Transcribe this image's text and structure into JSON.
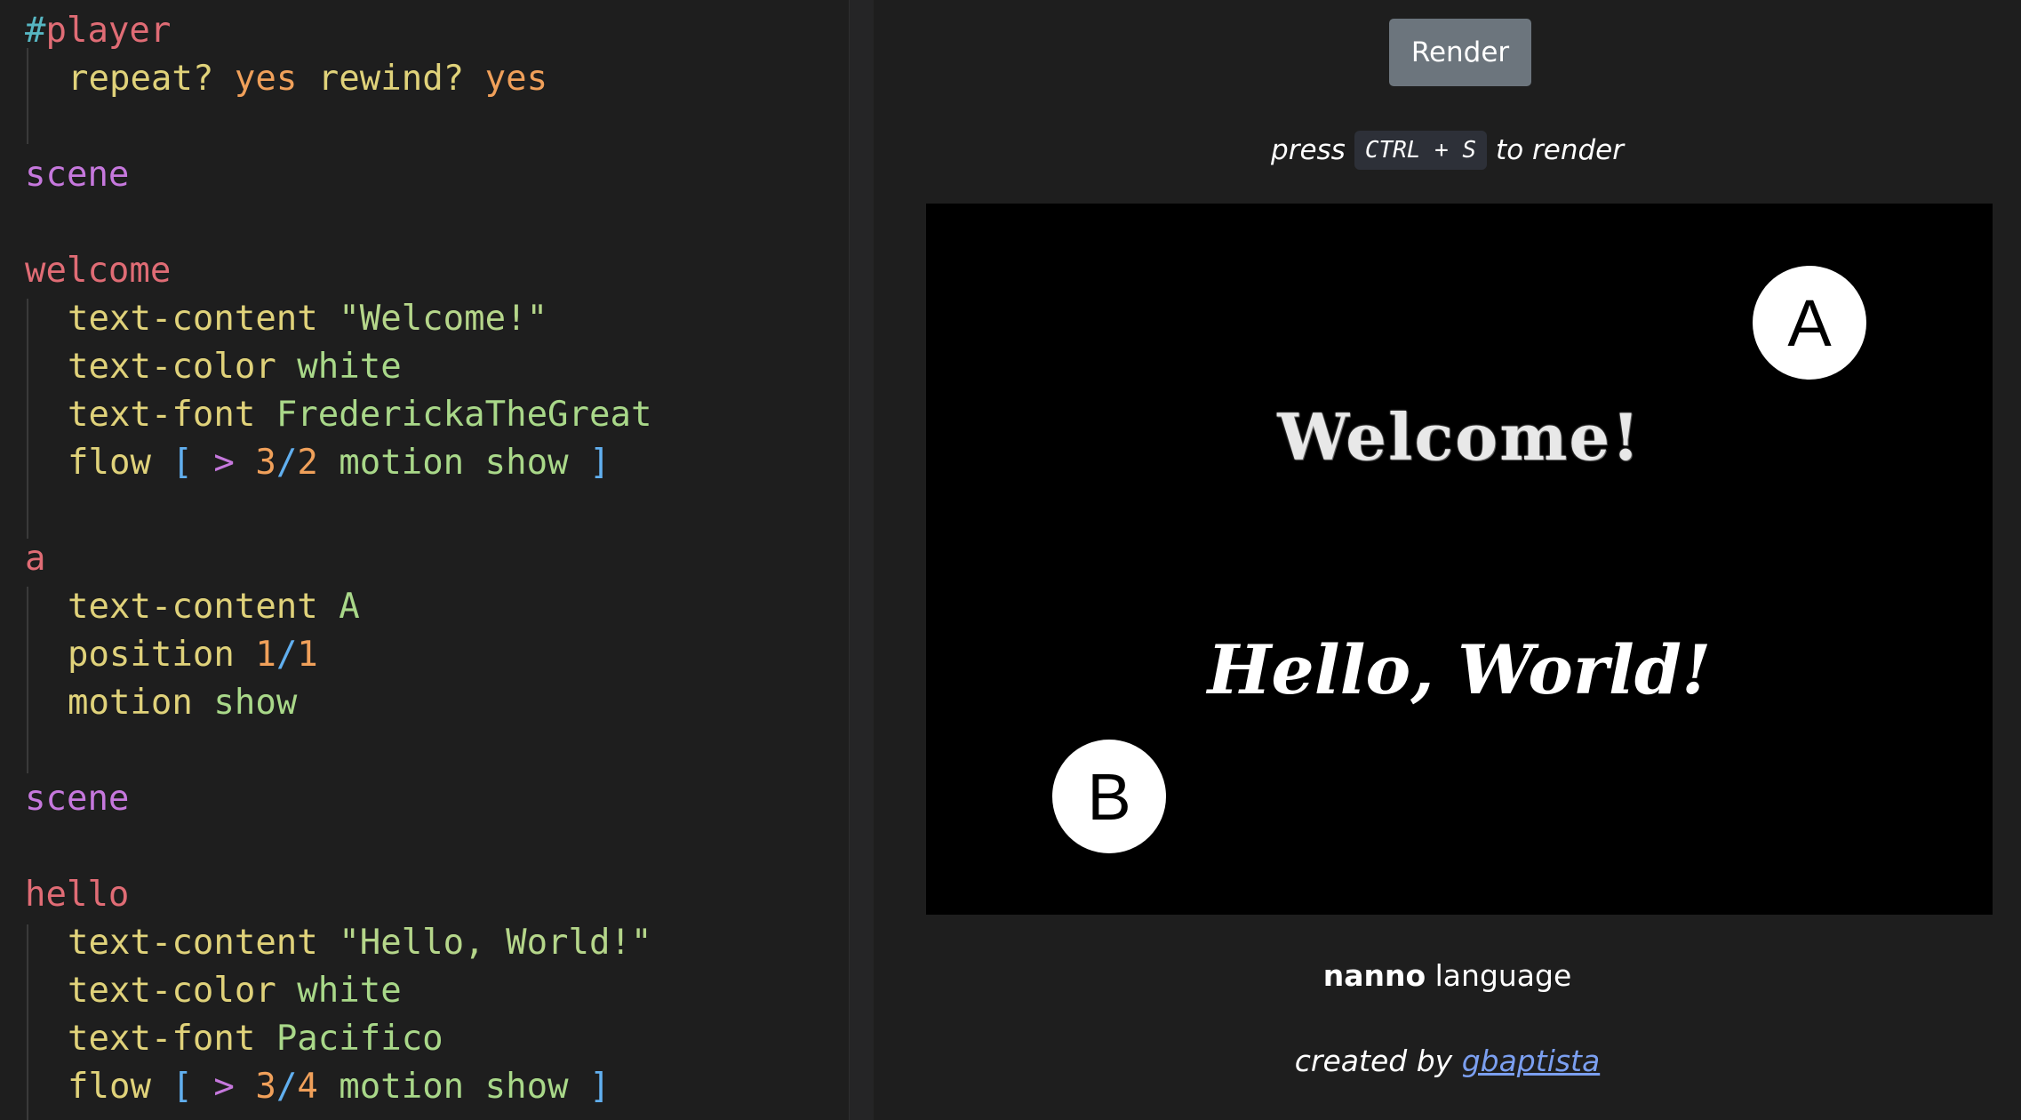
{
  "editor": {
    "lines": {
      "l1": [
        "#",
        "player"
      ],
      "l2": [
        "repeat?",
        "yes",
        "rewind?",
        "yes"
      ],
      "l3": [
        "scene"
      ],
      "l4": [
        "welcome"
      ],
      "l5": [
        "text-content",
        "\"Welcome!\""
      ],
      "l6": [
        "text-color",
        "white"
      ],
      "l7": [
        "text-font",
        "FrederickaTheGreat"
      ],
      "l8": [
        "flow",
        "[",
        ">",
        "3",
        "/",
        "2",
        "motion",
        "show",
        "]"
      ],
      "l9": [
        "a"
      ],
      "l10": [
        "text-content",
        "A"
      ],
      "l11": [
        "position",
        "1",
        "/",
        "1"
      ],
      "l12": [
        "motion",
        "show"
      ],
      "l13": [
        "scene"
      ],
      "l14": [
        "hello"
      ],
      "l15": [
        "text-content",
        "\"Hello, World!\""
      ],
      "l16": [
        "text-color",
        "white"
      ],
      "l17": [
        "text-font",
        "Pacifico"
      ],
      "l18": [
        "flow",
        "[",
        ">",
        "3",
        "/",
        "4",
        "motion",
        "show",
        "]"
      ]
    }
  },
  "preview": {
    "render_label": "Render",
    "hint_before": "press",
    "hint_key": "CTRL + S",
    "hint_after": "to render",
    "canvas": {
      "welcome": "Welcome!",
      "hello": "Hello, World!",
      "circle_a": "A",
      "circle_b": "B"
    },
    "brand_bold": "nanno",
    "brand_rest": "language",
    "credit_prefix": "created by",
    "credit_link": "gbaptista"
  },
  "colors": {
    "editor_bg": "#1e1e1e",
    "button_bg": "#6c757d",
    "link": "#7b9ff0",
    "keyword": "#e0d27a",
    "block_name": "#e06c75",
    "scene": "#c678dd"
  }
}
